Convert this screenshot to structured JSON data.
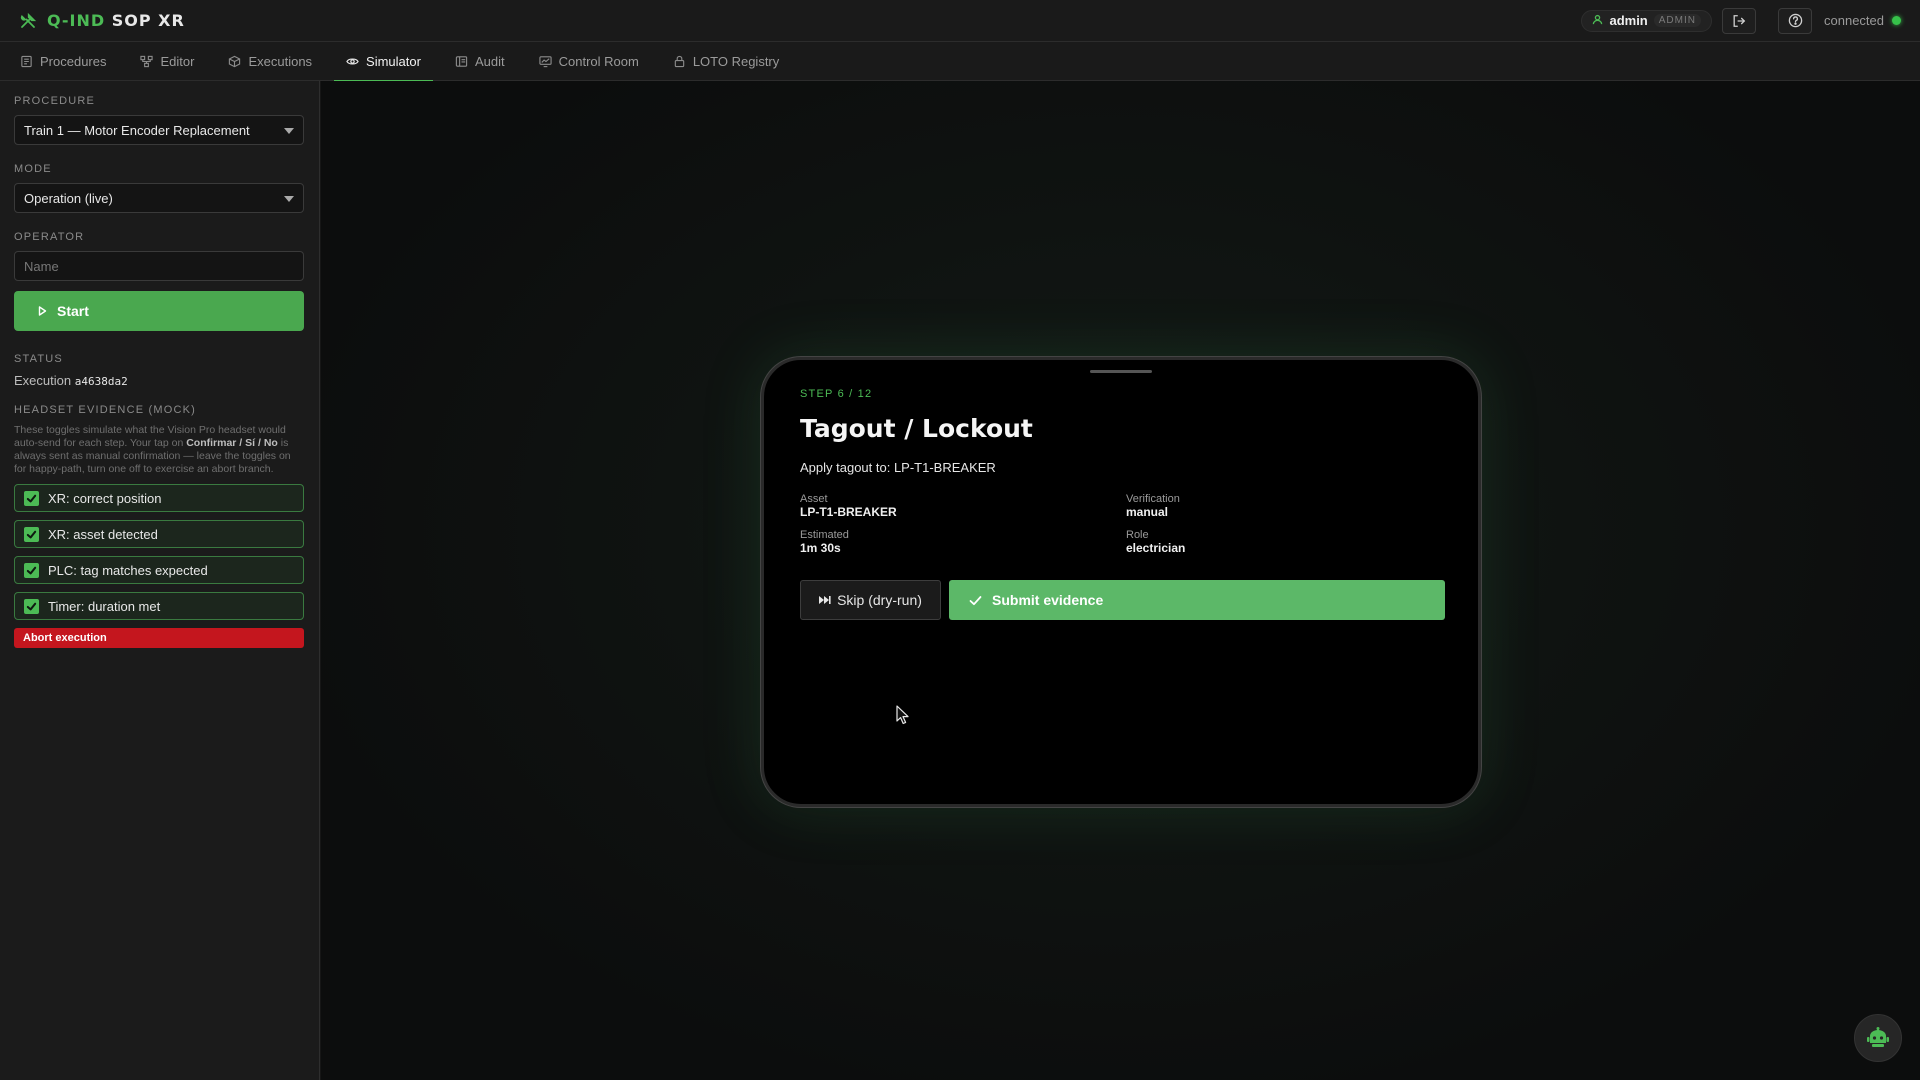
{
  "app": {
    "brand_a": "Q-IND",
    "brand_b": "SOP XR",
    "user": "admin",
    "role": "ADMIN",
    "connection": "connected",
    "accent_color": "#4cbb55",
    "danger_color": "#c4161e"
  },
  "nav": {
    "tabs": [
      {
        "label": "Procedures",
        "icon": "document-icon"
      },
      {
        "label": "Editor",
        "icon": "graph-icon"
      },
      {
        "label": "Executions",
        "icon": "cube-icon"
      },
      {
        "label": "Simulator",
        "icon": "eye-icon",
        "active": true
      },
      {
        "label": "Audit",
        "icon": "ledger-icon"
      },
      {
        "label": "Control Room",
        "icon": "monitor-icon"
      },
      {
        "label": "LOTO Registry",
        "icon": "lock-icon"
      }
    ]
  },
  "sidebar": {
    "procedure_label": "PROCEDURE",
    "procedure_value": "Train 1 — Motor Encoder Replacement",
    "mode_label": "MODE",
    "mode_value": "Operation (live)",
    "operator_label": "OPERATOR",
    "operator_placeholder": "Name",
    "start_label": "Start",
    "status_label": "STATUS",
    "execution_prefix": "Execution",
    "execution_id": "a4638da2",
    "evidence_label": "HEADSET EVIDENCE (MOCK)",
    "note_1": "These toggles simulate what the Vision Pro headset would auto-send for each step. Your tap on ",
    "note_bold": "Confirmar / Sí / No",
    "note_2": " is always sent as manual confirmation — leave the toggles on for happy-path, turn one off to exercise an abort branch.",
    "toggles": [
      {
        "label": "XR: correct position",
        "checked": true
      },
      {
        "label": "XR: asset detected",
        "checked": true
      },
      {
        "label": "PLC: tag matches expected",
        "checked": true
      },
      {
        "label": "Timer: duration met",
        "checked": true
      }
    ],
    "abort_label": "Abort execution"
  },
  "headset": {
    "step": "STEP 6 / 12",
    "title": "Tagout / Lockout",
    "instruction": "Apply tagout to: LP-T1-BREAKER",
    "meta": {
      "asset_label": "Asset",
      "asset_value": "LP-T1-BREAKER",
      "verification_label": "Verification",
      "verification_value": "manual",
      "estimated_label": "Estimated",
      "estimated_value": "1m 30s",
      "role_label": "Role",
      "role_value": "electrician"
    },
    "skip_label": "Skip (dry-run)",
    "submit_label": "Submit evidence"
  }
}
